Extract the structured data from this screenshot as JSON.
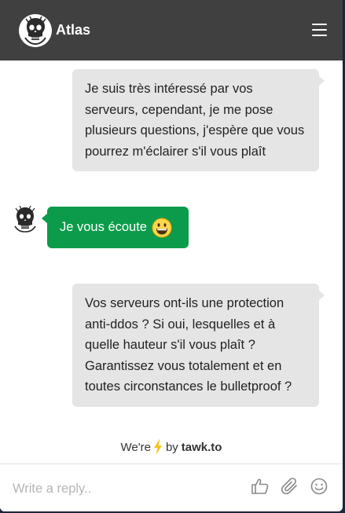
{
  "header": {
    "title": "Atlas",
    "avatar_icon": "skull-avatar-icon",
    "menu_icon": "hamburger-menu-icon",
    "bg_color": "#404040"
  },
  "messages": [
    {
      "sender": "visitor",
      "text": "Je suis très intéressé par vos serveurs, cependant, je me pose plusieurs questions, j'espère que vous pourrez m'éclairer s'il vous plaît"
    },
    {
      "sender": "agent",
      "text": "Je vous écoute",
      "emoji": "grinning-face-icon",
      "bg_color": "#0c9b4a"
    },
    {
      "sender": "visitor",
      "text": "Vos serveurs ont-ils une protection anti-ddos ? Si oui, lesquelles et à quelle hauteur s'il vous plaît ? Garantissez vous totalement et en toutes circonstances le bulletproof ?"
    }
  ],
  "powered_by": {
    "prefix": "We're",
    "middle": "by",
    "brand": "tawk.to",
    "icon": "lightning-bolt-icon"
  },
  "composer": {
    "placeholder": "Write a reply..",
    "value": "",
    "icons": [
      "thumbs-up-icon",
      "paperclip-icon",
      "smiley-icon"
    ]
  }
}
